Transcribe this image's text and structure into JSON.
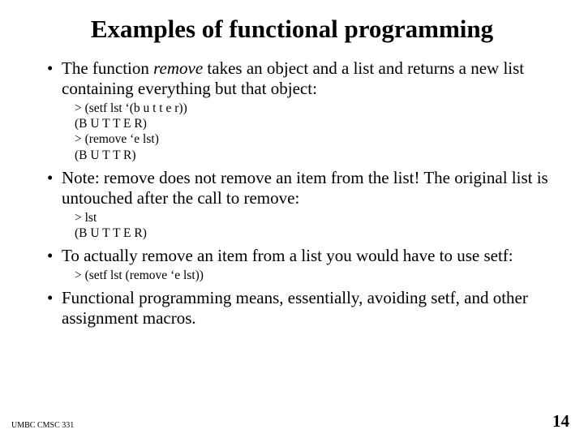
{
  "title": "Examples of functional programming",
  "b1_pre": "The function ",
  "b1_em": "remove",
  "b1_post": " takes an object and a list and returns a new list containing everything but that object:",
  "code1_l1": "> (setf  lst  ‘(b u t t e r))",
  "code1_l2": "(B U T T E R)",
  "code1_l3": "> (remove ‘e lst)",
  "code1_l4": "(B U T T R)",
  "b2": "Note:  remove does not remove an item from the list!  The original list is untouched after the call to remove:",
  "code2_l1": "> lst",
  "code2_l2": "(B U T T E R)",
  "b3": "To actually remove an item from a list you would have to use setf:",
  "code3_l1": "> (setf  lst  (remove ‘e lst))",
  "b4": "Functional programming means, essentially, avoiding setf, and other assignment macros.",
  "footer_left": "UMBC CMSC 331",
  "footer_right": "14",
  "dot": "•"
}
